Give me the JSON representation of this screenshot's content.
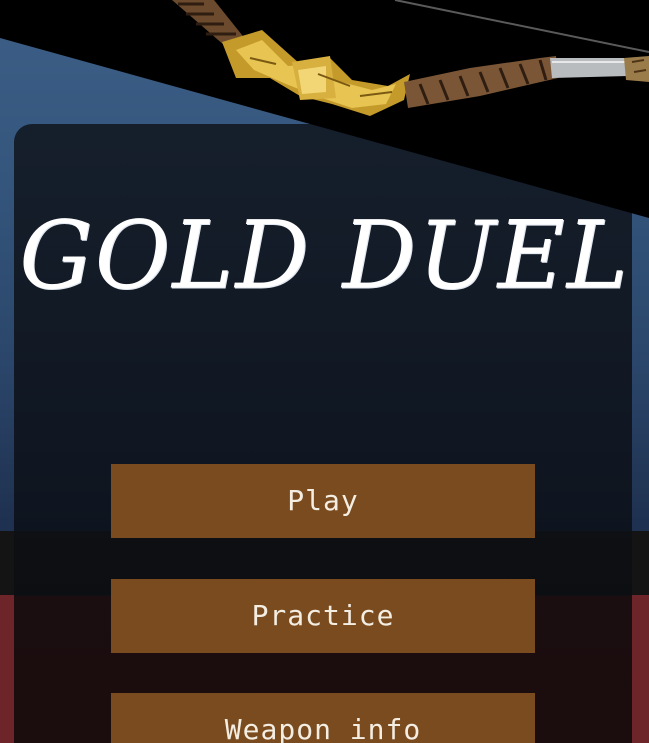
{
  "game": {
    "title": "GOLD DUEL"
  },
  "menu": {
    "play_label": "Play",
    "practice_label": "Practice",
    "weapon_info_label": "Weapon info"
  },
  "colors": {
    "background_top": "#3d5f87",
    "panel": "#141c28",
    "button": "#7a4b1e",
    "button_text": "#f4ede2",
    "title_text": "#ffffff",
    "lower_band_red": "#6e2529"
  },
  "icons": {
    "banner": "golden-bow-icon"
  }
}
